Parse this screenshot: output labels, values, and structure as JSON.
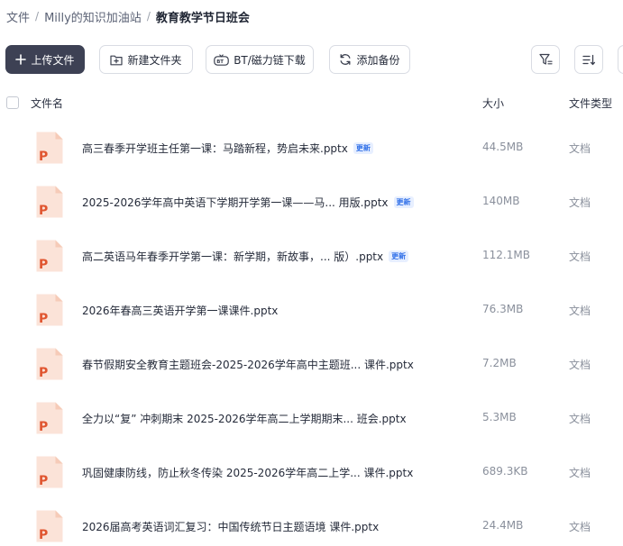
{
  "breadcrumb": {
    "items": [
      "文件",
      "Milly的知识加油站",
      "教育教学节日班会"
    ],
    "separator": "/"
  },
  "toolbar": {
    "upload_label": "上传文件",
    "new_folder_label": "新建文件夹",
    "bt_label": "BT/磁力链下载",
    "backup_label": "添加备份"
  },
  "table": {
    "headers": {
      "name": "文件名",
      "size": "大小",
      "type": "文件类型"
    }
  },
  "files": [
    {
      "name": "高三春季开学班主任第一课：马踏新程，势启未来.pptx",
      "badge": "更新",
      "size": "44.5MB",
      "type": "文档"
    },
    {
      "name": "2025-2026学年高中英语下学期开学第一课——马... 用版.pptx",
      "badge": "更新",
      "size": "140MB",
      "type": "文档"
    },
    {
      "name": "高二英语马年春季开学第一课：新学期，新故事，...  版）.pptx",
      "badge": "更新",
      "size": "112.1MB",
      "type": "文档"
    },
    {
      "name": "2026年春高三英语开学第一课课件.pptx",
      "badge": "",
      "size": "76.3MB",
      "type": "文档"
    },
    {
      "name": "春节假期安全教育主题班会-2025-2026学年高中主题班... 课件.pptx",
      "badge": "",
      "size": "7.2MB",
      "type": "文档"
    },
    {
      "name": "全力以“复” 冲刺期末 2025-2026学年高二上学期期末... 班会.pptx",
      "badge": "",
      "size": "5.3MB",
      "type": "文档"
    },
    {
      "name": "巩固健康防线，防止秋冬传染 2025-2026学年高二上学...  课件.pptx",
      "badge": "",
      "size": "689.3KB",
      "type": "文档"
    },
    {
      "name": "2026届高考英语词汇复习：中国传统节日主题语境 课件.pptx",
      "badge": "",
      "size": "24.4MB",
      "type": "文档"
    }
  ],
  "icons": {
    "ppt_letter": "P",
    "colors": {
      "ppt_dark": "#e0552f",
      "ppt_light": "#fbe3d8",
      "primary_button": "#3d4154",
      "badge_text": "#2f6fe8"
    }
  }
}
